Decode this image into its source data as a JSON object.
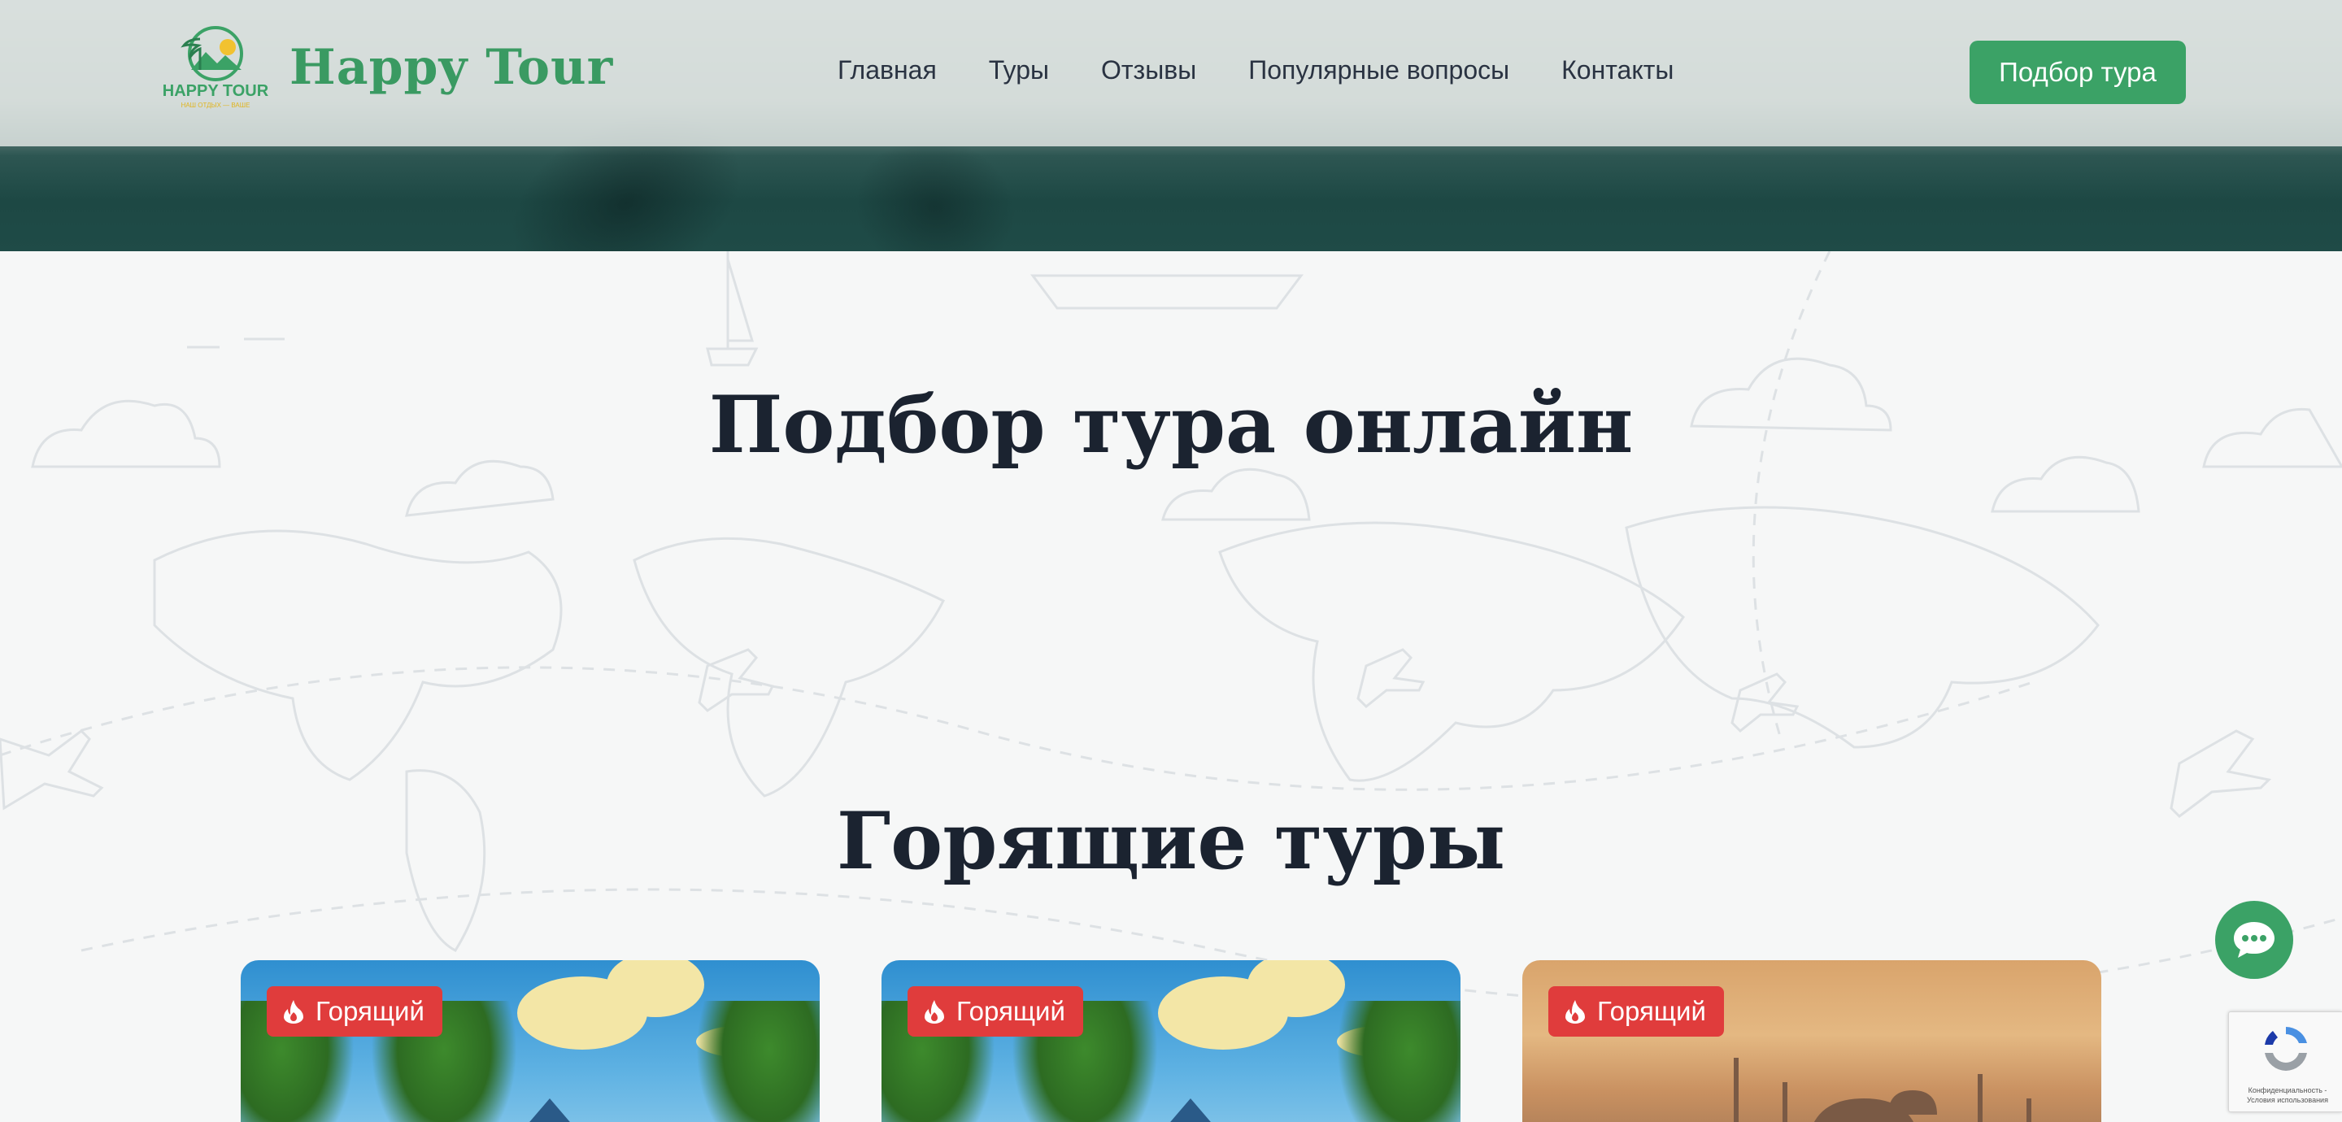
{
  "header": {
    "logo_text": "HAPPY TOUR",
    "logo_subtext": "НАШ ОТДЫХ — ВАШЕ",
    "brand": "Happy Tour",
    "nav": [
      "Главная",
      "Туры",
      "Отзывы",
      "Популярные вопросы",
      "Контакты"
    ],
    "cta_label": "Подбор тура"
  },
  "sections": {
    "search_title": "Подбор тура онлайн",
    "hot_title": "Горящие туры"
  },
  "cards": [
    {
      "badge": "Горящий",
      "image": "tropical-island"
    },
    {
      "badge": "Горящий",
      "image": "tropical-island"
    },
    {
      "badge": "Горящий",
      "image": "istanbul-mosques"
    }
  ],
  "chat_icon": "chat-bubble-icon",
  "recaptcha": {
    "text": "Конфиденциальность - Условия использования"
  },
  "colors": {
    "accent": "#3ba266",
    "badge": "#e03c3c",
    "title": "#1b2330"
  }
}
